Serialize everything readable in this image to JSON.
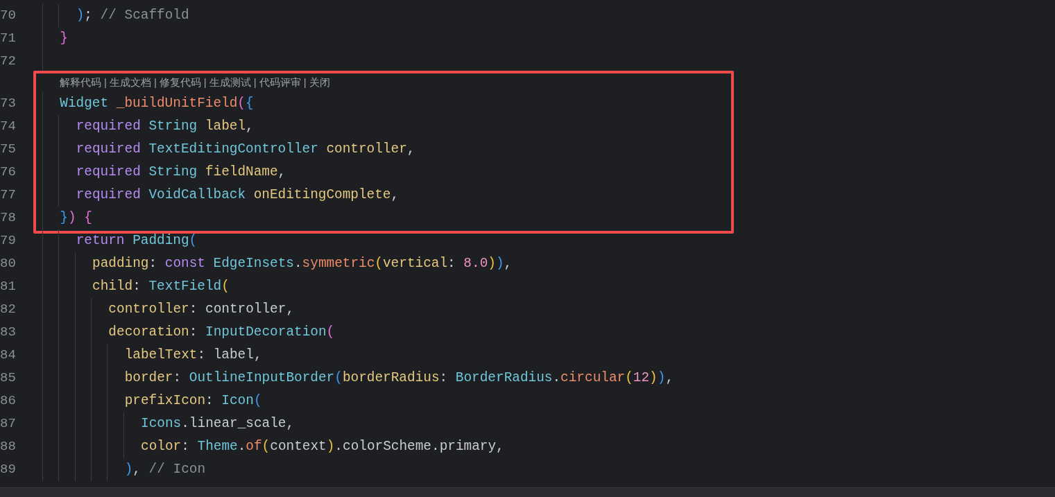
{
  "blocks": [
    {
      "highlighted": false,
      "lines": [
        {
          "children": [
            {
              "number": "70",
              "tokens": [
                {
                  "text": ")",
                  "kind": "b1"
                },
                {
                  "text": "; ",
                  "kind": "plain"
                },
                {
                  "text": "// Scaffold",
                  "kind": "comment"
                }
              ]
            }
          ]
        },
        {
          "number": "71",
          "tokens": [
            {
              "text": "}",
              "kind": "b3"
            }
          ]
        },
        {
          "number": "72"
        }
      ]
    },
    {
      "highlighted": true,
      "lens": [
        {
          "label": "解释代码",
          "separator": "|"
        },
        {
          "label": "生成文档",
          "separator": "|"
        },
        {
          "label": "修复代码",
          "separator": "|"
        },
        {
          "label": "生成测试",
          "separator": "|"
        },
        {
          "label": "代码评审",
          "separator": "|"
        },
        {
          "label": "关闭"
        }
      ],
      "lines": [
        {
          "number": "73",
          "tokens": [
            {
              "text": "Widget ",
              "kind": "type"
            },
            {
              "text": "_buildUnitField",
              "kind": "fn"
            },
            {
              "text": "(",
              "kind": "b3"
            },
            {
              "text": "{",
              "kind": "b1"
            }
          ],
          "children": [
            {
              "number": "74",
              "tokens": [
                {
                  "text": "required ",
                  "kind": "kw"
                },
                {
                  "text": "String ",
                  "kind": "type"
                },
                {
                  "text": "label",
                  "kind": "param"
                },
                {
                  "text": ",",
                  "kind": "plain"
                }
              ]
            },
            {
              "number": "75",
              "tokens": [
                {
                  "text": "required ",
                  "kind": "kw"
                },
                {
                  "text": "TextEditingController ",
                  "kind": "type"
                },
                {
                  "text": "controller",
                  "kind": "param"
                },
                {
                  "text": ",",
                  "kind": "plain"
                }
              ]
            },
            {
              "number": "76",
              "tokens": [
                {
                  "text": "required ",
                  "kind": "kw"
                },
                {
                  "text": "String ",
                  "kind": "type"
                },
                {
                  "text": "fieldName",
                  "kind": "param"
                },
                {
                  "text": ",",
                  "kind": "plain"
                }
              ]
            },
            {
              "number": "77",
              "tokens": [
                {
                  "text": "required ",
                  "kind": "kw"
                },
                {
                  "text": "VoidCallback ",
                  "kind": "type"
                },
                {
                  "text": "onEditingComplete",
                  "kind": "param"
                },
                {
                  "text": ",",
                  "kind": "plain"
                }
              ]
            }
          ]
        },
        {
          "number": "78",
          "tokens": [
            {
              "text": "}",
              "kind": "b1"
            },
            {
              "text": ") ",
              "kind": "b3"
            },
            {
              "text": "{",
              "kind": "b3"
            }
          ]
        }
      ]
    },
    {
      "highlighted": false,
      "lines": [
        {
          "children": [
            {
              "number": "79",
              "tokens": [
                {
                  "text": "return ",
                  "kind": "kw"
                },
                {
                  "text": "Padding",
                  "kind": "type"
                },
                {
                  "text": "(",
                  "kind": "b1"
                }
              ],
              "children": [
                {
                  "number": "80",
                  "tokens": [
                    {
                      "text": "padding",
                      "kind": "param"
                    },
                    {
                      "text": ": ",
                      "kind": "plain"
                    },
                    {
                      "text": "const ",
                      "kind": "kw"
                    },
                    {
                      "text": "EdgeInsets",
                      "kind": "type"
                    },
                    {
                      "text": ".",
                      "kind": "plain"
                    },
                    {
                      "text": "symmetric",
                      "kind": "fn"
                    },
                    {
                      "text": "(",
                      "kind": "b2"
                    },
                    {
                      "text": "vertical",
                      "kind": "param"
                    },
                    {
                      "text": ": ",
                      "kind": "plain"
                    },
                    {
                      "text": "8.0",
                      "kind": "num"
                    },
                    {
                      "text": ")",
                      "kind": "b2"
                    },
                    {
                      "text": ")",
                      "kind": "b1"
                    },
                    {
                      "text": ",",
                      "kind": "plain"
                    }
                  ]
                },
                {
                  "number": "81",
                  "tokens": [
                    {
                      "text": "child",
                      "kind": "param"
                    },
                    {
                      "text": ": ",
                      "kind": "plain"
                    },
                    {
                      "text": "TextField",
                      "kind": "type"
                    },
                    {
                      "text": "(",
                      "kind": "b2"
                    }
                  ],
                  "children": [
                    {
                      "number": "82",
                      "tokens": [
                        {
                          "text": "controller",
                          "kind": "param"
                        },
                        {
                          "text": ": ",
                          "kind": "plain"
                        },
                        {
                          "text": "controller",
                          "kind": "plain"
                        },
                        {
                          "text": ",",
                          "kind": "plain"
                        }
                      ]
                    },
                    {
                      "number": "83",
                      "tokens": [
                        {
                          "text": "decoration",
                          "kind": "param"
                        },
                        {
                          "text": ": ",
                          "kind": "plain"
                        },
                        {
                          "text": "InputDecoration",
                          "kind": "type"
                        },
                        {
                          "text": "(",
                          "kind": "b3"
                        }
                      ],
                      "children": [
                        {
                          "number": "84",
                          "tokens": [
                            {
                              "text": "labelText",
                              "kind": "param"
                            },
                            {
                              "text": ": ",
                              "kind": "plain"
                            },
                            {
                              "text": "label",
                              "kind": "plain"
                            },
                            {
                              "text": ",",
                              "kind": "plain"
                            }
                          ]
                        },
                        {
                          "number": "85",
                          "tokens": [
                            {
                              "text": "border",
                              "kind": "param"
                            },
                            {
                              "text": ": ",
                              "kind": "plain"
                            },
                            {
                              "text": "OutlineInputBorder",
                              "kind": "type"
                            },
                            {
                              "text": "(",
                              "kind": "b1"
                            },
                            {
                              "text": "borderRadius",
                              "kind": "param"
                            },
                            {
                              "text": ": ",
                              "kind": "plain"
                            },
                            {
                              "text": "BorderRadius",
                              "kind": "type"
                            },
                            {
                              "text": ".",
                              "kind": "plain"
                            },
                            {
                              "text": "circular",
                              "kind": "fn"
                            },
                            {
                              "text": "(",
                              "kind": "b2"
                            },
                            {
                              "text": "12",
                              "kind": "num"
                            },
                            {
                              "text": ")",
                              "kind": "b2"
                            },
                            {
                              "text": ")",
                              "kind": "b1"
                            },
                            {
                              "text": ",",
                              "kind": "plain"
                            }
                          ]
                        },
                        {
                          "number": "86",
                          "tokens": [
                            {
                              "text": "prefixIcon",
                              "kind": "param"
                            },
                            {
                              "text": ": ",
                              "kind": "plain"
                            },
                            {
                              "text": "Icon",
                              "kind": "type"
                            },
                            {
                              "text": "(",
                              "kind": "b1"
                            }
                          ],
                          "children": [
                            {
                              "number": "87",
                              "tokens": [
                                {
                                  "text": "Icons",
                                  "kind": "type"
                                },
                                {
                                  "text": ".",
                                  "kind": "plain"
                                },
                                {
                                  "text": "linear_scale",
                                  "kind": "plain"
                                },
                                {
                                  "text": ",",
                                  "kind": "plain"
                                }
                              ]
                            },
                            {
                              "number": "88",
                              "tokens": [
                                {
                                  "text": "color",
                                  "kind": "param"
                                },
                                {
                                  "text": ": ",
                                  "kind": "plain"
                                },
                                {
                                  "text": "Theme",
                                  "kind": "type"
                                },
                                {
                                  "text": ".",
                                  "kind": "plain"
                                },
                                {
                                  "text": "of",
                                  "kind": "fn"
                                },
                                {
                                  "text": "(",
                                  "kind": "b2"
                                },
                                {
                                  "text": "context",
                                  "kind": "plain"
                                },
                                {
                                  "text": ")",
                                  "kind": "b2"
                                },
                                {
                                  "text": ".colorScheme.primary",
                                  "kind": "plain"
                                },
                                {
                                  "text": ",",
                                  "kind": "plain"
                                }
                              ]
                            }
                          ]
                        },
                        {
                          "number": "89",
                          "tokens": [
                            {
                              "text": ")",
                              "kind": "b1"
                            },
                            {
                              "text": ", ",
                              "kind": "plain"
                            },
                            {
                              "text": "// Icon",
                              "kind": "comment"
                            }
                          ]
                        }
                      ]
                    }
                  ]
                }
              ]
            }
          ]
        }
      ]
    }
  ]
}
